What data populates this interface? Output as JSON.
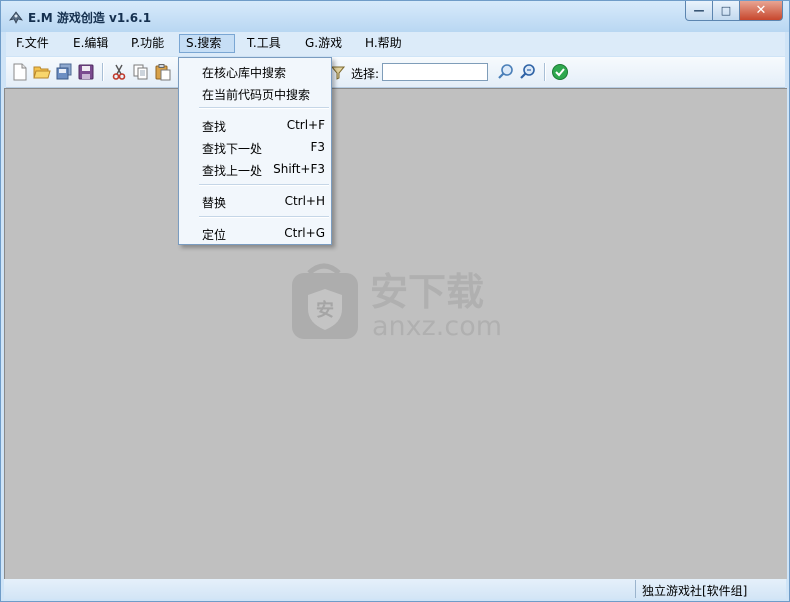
{
  "window": {
    "title": "E.M 游戏创造 v1.6.1",
    "buttons": {
      "minimize": "—",
      "maximize": "□",
      "close": "✕"
    }
  },
  "menubar": {
    "items": [
      {
        "label": "F.文件"
      },
      {
        "label": "E.编辑"
      },
      {
        "label": "P.功能"
      },
      {
        "label": "S.搜索"
      },
      {
        "label": "T.工具"
      },
      {
        "label": "G.游戏"
      },
      {
        "label": "H.帮助"
      }
    ],
    "active_index": 3
  },
  "toolbar": {
    "buttons": [
      "new-file-icon",
      "open-folder-icon",
      "save-all-icon",
      "save-icon",
      "cut-icon",
      "copy-icon",
      "paste-icon",
      "filter-icon",
      "search-icon",
      "search-next-icon",
      "check-icon"
    ],
    "select_label": "选择:",
    "select_value": ""
  },
  "search_menu": {
    "items": [
      {
        "label": "在核心库中搜索",
        "shortcut": ""
      },
      {
        "label": "在当前代码页中搜索",
        "shortcut": ""
      },
      {
        "label": "查找",
        "shortcut": "Ctrl+F"
      },
      {
        "label": "查找下一处",
        "shortcut": "F3"
      },
      {
        "label": "查找上一处",
        "shortcut": "Shift+F3"
      },
      {
        "label": "替换",
        "shortcut": "Ctrl+H"
      },
      {
        "label": "定位",
        "shortcut": "Ctrl+G"
      }
    ]
  },
  "watermark": {
    "text_cn": "安下载",
    "text_en": "anxz.com",
    "badge": "安"
  },
  "statusbar": {
    "text": "独立游戏社[软件组]"
  },
  "colors": {
    "client_bg": "#c0c0c0",
    "menu_active": "#c6def5",
    "accent": "#3a7bd5"
  }
}
